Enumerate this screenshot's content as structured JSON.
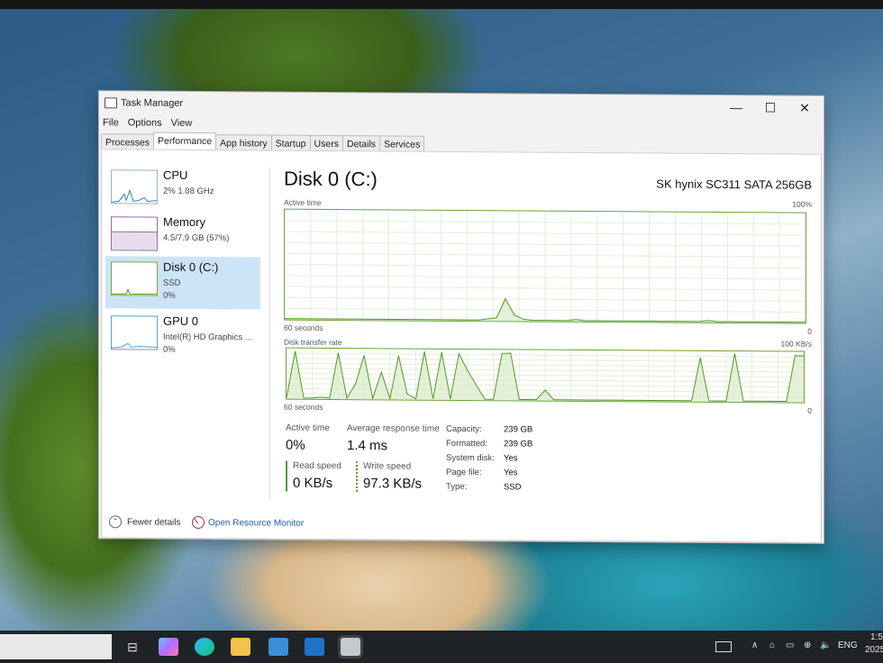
{
  "window": {
    "title": "Task Manager",
    "minimize": "—",
    "maximize": "☐",
    "close": "✕"
  },
  "menu": [
    "File",
    "Options",
    "View"
  ],
  "tabs": [
    "Processes",
    "Performance",
    "App history",
    "Startup",
    "Users",
    "Details",
    "Services"
  ],
  "active_tab": "Performance",
  "sidebar": {
    "cpu": {
      "name": "CPU",
      "line1": "2% 1.08 GHz"
    },
    "memory": {
      "name": "Memory",
      "line1": "4.5/7.9 GB (57%)"
    },
    "disk": {
      "name": "Disk 0 (C:)",
      "line1": "SSD",
      "line2": "0%"
    },
    "gpu": {
      "name": "GPU 0",
      "line1": "Intel(R) HD Graphics ...",
      "line2": "0%"
    }
  },
  "detail": {
    "title": "Disk 0 (C:)",
    "model": "SK hynix SC311 SATA 256GB",
    "active_graph": {
      "label": "Active time",
      "max": "100%",
      "time": "60 seconds",
      "min": "0"
    },
    "transfer_graph": {
      "label": "Disk transfer rate",
      "max": "100 KB/s",
      "time": "60 seconds",
      "min": "0"
    },
    "stats": {
      "active_time_label": "Active time",
      "active_time": "0%",
      "response_label": "Average response time",
      "response": "1.4 ms",
      "read_label": "Read speed",
      "read": "0 KB/s",
      "write_label": "Write speed",
      "write": "97.3 KB/s"
    },
    "properties": [
      {
        "label": "Capacity:",
        "value": "239 GB"
      },
      {
        "label": "Formatted:",
        "value": "239 GB"
      },
      {
        "label": "System disk:",
        "value": "Yes"
      },
      {
        "label": "Page file:",
        "value": "Yes"
      },
      {
        "label": "Type:",
        "value": "SSD"
      }
    ]
  },
  "footer": {
    "fewer_details": "Fewer details",
    "resource_monitor": "Open Resource Monitor"
  },
  "taskbar": {
    "lang": "ENG",
    "time": "1:5",
    "year": "2025"
  },
  "graph_series": {
    "active_time_percent": [
      0,
      0,
      0,
      0,
      0,
      0,
      0,
      0,
      0,
      0,
      0,
      0,
      0,
      0,
      0,
      0,
      0,
      0,
      0,
      0,
      0,
      0,
      0,
      1,
      2,
      20,
      5,
      1,
      0,
      0,
      0,
      0,
      0,
      1,
      0,
      0,
      0,
      0,
      0,
      0,
      0,
      0,
      0,
      0,
      0,
      0,
      0,
      0,
      1,
      0,
      0,
      0,
      0,
      0,
      0,
      0,
      0,
      0,
      0,
      0
    ],
    "transfer_kbps": [
      0,
      98,
      0,
      0,
      2,
      0,
      95,
      0,
      30,
      90,
      0,
      55,
      0,
      90,
      10,
      0,
      99,
      0,
      98,
      0,
      95,
      60,
      30,
      0,
      0,
      96,
      97,
      0,
      0,
      0,
      20,
      0,
      0,
      0,
      0,
      0,
      0,
      0,
      0,
      0,
      0,
      0,
      0,
      0,
      0,
      0,
      0,
      0,
      90,
      0,
      0,
      0,
      99,
      0,
      0,
      0,
      0,
      0,
      0,
      96,
      95
    ]
  },
  "colors": {
    "disk_green": "#4f9b24",
    "selected_bg": "#cce4f7",
    "link": "#1a5fb4"
  }
}
